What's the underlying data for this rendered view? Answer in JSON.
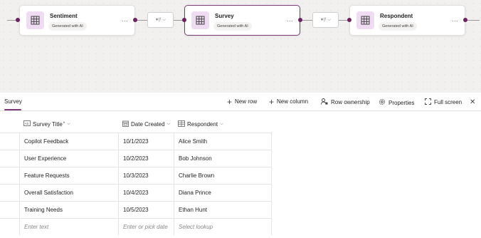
{
  "canvas": {
    "nodes": [
      {
        "title": "Sentiment",
        "badge": "Generated with AI",
        "more": "..."
      },
      {
        "title": "Survey",
        "badge": "Generated with AI",
        "more": "..."
      },
      {
        "title": "Respondent",
        "badge": "Generated with AI",
        "more": "..."
      }
    ],
    "relationships": [
      {
        "label": "∗|¹ ⌵"
      },
      {
        "label": "∗|¹ ⌵"
      }
    ]
  },
  "toolbar": {
    "active_tab": "Survey",
    "new_row": "New row",
    "new_column": "New column",
    "row_ownership": "Row ownership",
    "properties": "Properties",
    "full_screen": "Full screen",
    "close": "✕"
  },
  "table": {
    "columns": [
      {
        "label": "Survey Title",
        "required": "*",
        "icon": "text-field-icon"
      },
      {
        "label": "Date Created",
        "icon": "calendar-icon"
      },
      {
        "label": "Respondent",
        "icon": "lookup-icon"
      }
    ],
    "rows": [
      [
        "Copilot Feedback",
        "10/1/2023",
        "Alice Smith"
      ],
      [
        "User Experience",
        "10/2/2023",
        "Bob Johnson"
      ],
      [
        "Feature Requests",
        "10/3/2023",
        "Charlie Brown"
      ],
      [
        "Overall Satisfaction",
        "10/4/2023",
        "Diana Prince"
      ],
      [
        "Training Needs",
        "10/5/2023",
        "Ethan Hunt"
      ]
    ],
    "new_row_placeholders": [
      "Enter text",
      "Enter or pick date",
      "Select lookup"
    ]
  },
  "colors": {
    "accent": "#7c3b78",
    "node_dot": "#6b2162",
    "table_icon_bg": "#efdcf2"
  }
}
